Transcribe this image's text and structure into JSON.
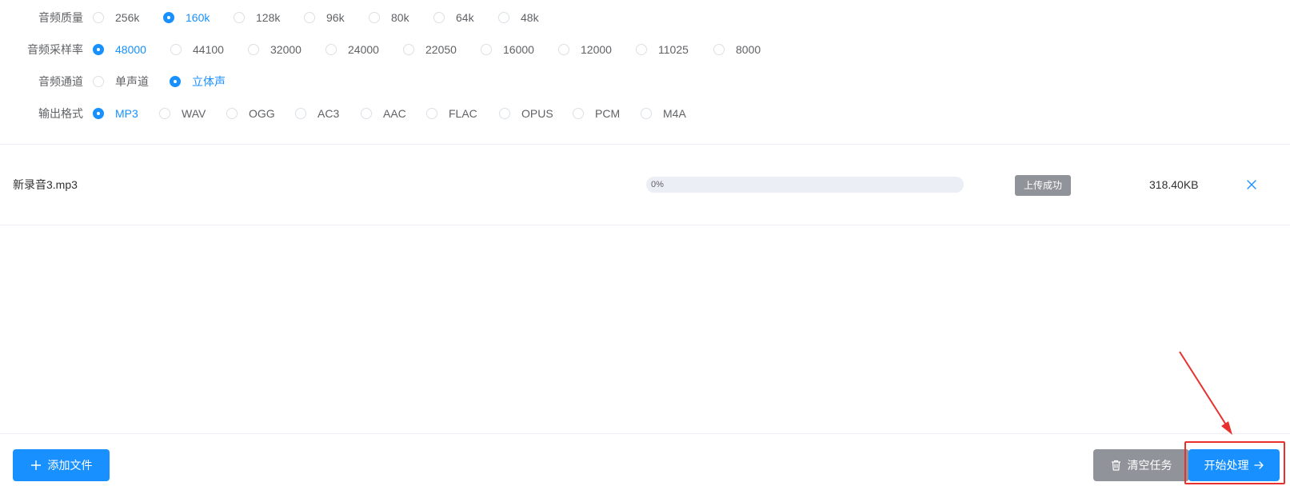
{
  "settings": {
    "quality": {
      "label": "音频质量",
      "options": [
        "256k",
        "160k",
        "128k",
        "96k",
        "80k",
        "64k",
        "48k"
      ],
      "selected": "160k"
    },
    "sample_rate": {
      "label": "音频采样率",
      "options": [
        "48000",
        "44100",
        "32000",
        "24000",
        "22050",
        "16000",
        "12000",
        "11025",
        "8000"
      ],
      "selected": "48000"
    },
    "channel": {
      "label": "音频通道",
      "options": [
        "单声道",
        "立体声"
      ],
      "selected": "立体声"
    },
    "format": {
      "label": "输出格式",
      "options": [
        "MP3",
        "WAV",
        "OGG",
        "AC3",
        "AAC",
        "FLAC",
        "OPUS",
        "PCM",
        "M4A"
      ],
      "selected": "MP3"
    }
  },
  "file": {
    "name": "新录音3.mp3",
    "progress_text": "0%",
    "progress_fraction": 0,
    "status": "上传成功",
    "size": "318.40KB"
  },
  "footer": {
    "add_label": "添加文件",
    "clear_label": "清空任务",
    "start_label": "开始处理"
  },
  "icons": {
    "add": "plus-icon",
    "clear": "trash-icon",
    "start": "arrow-right-icon",
    "remove": "close-icon"
  },
  "colors": {
    "primary": "#1890ff",
    "neutral": "#909399",
    "annotation": "#e8312f"
  }
}
